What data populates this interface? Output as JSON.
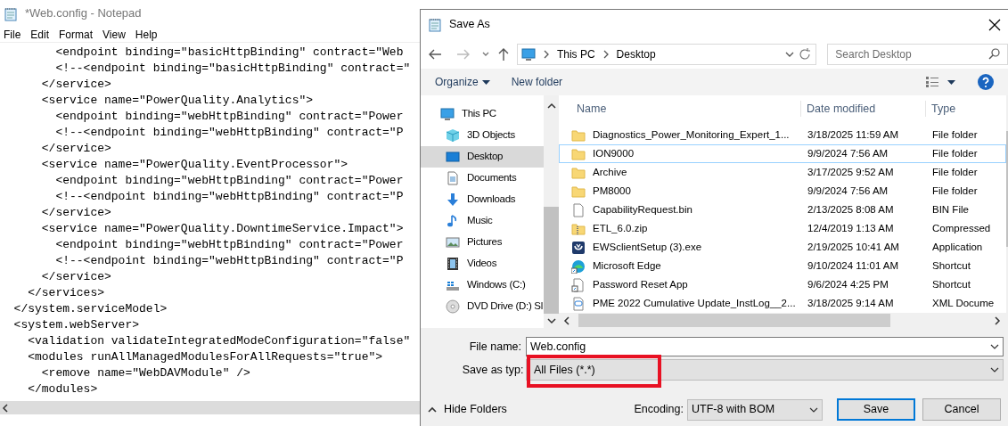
{
  "notepad": {
    "title": "*Web.config - Notepad",
    "menu": [
      "File",
      "Edit",
      "Format",
      "View",
      "Help"
    ],
    "lines": [
      "        <endpoint binding=\"basicHttpBinding\" contract=\"Web",
      "        <!--<endpoint binding=\"basicHttpBinding\" contract=\"",
      "      </service>",
      "      <service name=\"PowerQuality.Analytics\">",
      "        <endpoint binding=\"webHttpBinding\" contract=\"Power",
      "        <!--<endpoint binding=\"webHttpBinding\" contract=\"P",
      "      </service>",
      "      <service name=\"PowerQuality.EventProcessor\">",
      "        <endpoint binding=\"webHttpBinding\" contract=\"Power",
      "        <!--<endpoint binding=\"webHttpBinding\" contract=\"P",
      "      </service>",
      "      <service name=\"PowerQuality.DowntimeService.Impact\">",
      "        <endpoint binding=\"webHttpBinding\" contract=\"Power",
      "        <!--<endpoint binding=\"webHttpBinding\" contract=\"P",
      "      </service>",
      "    </services>",
      "  </system.serviceModel>",
      "  <system.webServer>",
      "    <validation validateIntegratedModeConfiguration=\"false\"",
      "    <modules runAllManagedModulesForAllRequests=\"true\">",
      "      <remove name=\"WebDAVModule\" />",
      "    </modules>"
    ]
  },
  "dialog": {
    "title": "Save As",
    "breadcrumb": [
      "This PC",
      "Desktop"
    ],
    "search": {
      "placeholder": "Search Desktop"
    },
    "toolbar": {
      "organize": "Organize",
      "new_folder": "New folder"
    },
    "nav_items": [
      {
        "kind": "pc",
        "label": "This PC",
        "selected": false
      },
      {
        "kind": "cube",
        "label": "3D Objects",
        "selected": false
      },
      {
        "kind": "desktop",
        "label": "Desktop",
        "selected": true
      },
      {
        "kind": "documents",
        "label": "Documents",
        "selected": false
      },
      {
        "kind": "downloads",
        "label": "Downloads",
        "selected": false
      },
      {
        "kind": "music",
        "label": "Music",
        "selected": false
      },
      {
        "kind": "pictures",
        "label": "Pictures",
        "selected": false
      },
      {
        "kind": "videos",
        "label": "Videos",
        "selected": false
      },
      {
        "kind": "drive",
        "label": "Windows (C:)",
        "selected": false
      },
      {
        "kind": "dvd",
        "label": "DVD Drive (D:) Sl",
        "selected": false
      }
    ],
    "columns": [
      "Name",
      "Date modified",
      "Type"
    ],
    "files": [
      {
        "kind": "folder",
        "name": "Diagnostics_Power_Monitoring_Expert_1...",
        "date": "3/18/2025 11:59 AM",
        "type": "File folder",
        "focused": false
      },
      {
        "kind": "folder",
        "name": "ION9000",
        "date": "9/9/2024 7:56 AM",
        "type": "File folder",
        "focused": true
      },
      {
        "kind": "folder",
        "name": "Archive",
        "date": "3/17/2025 9:52 AM",
        "type": "File folder",
        "focused": false
      },
      {
        "kind": "folder",
        "name": "PM8000",
        "date": "9/9/2024 7:56 AM",
        "type": "File folder",
        "focused": false
      },
      {
        "kind": "file",
        "name": "CapabilityRequest.bin",
        "date": "2/13/2025 8:08 AM",
        "type": "BIN File",
        "focused": false
      },
      {
        "kind": "zip",
        "name": "ETL_6.0.zip",
        "date": "12/4/2019 1:13 AM",
        "type": "Compressed",
        "focused": false
      },
      {
        "kind": "installer",
        "name": "EWSclientSetup (3).exe",
        "date": "2/19/2025 10:41 AM",
        "type": "Application",
        "focused": false
      },
      {
        "kind": "edge",
        "name": "Microsoft Edge",
        "date": "9/10/2024 11:01 AM",
        "type": "Shortcut",
        "focused": false
      },
      {
        "kind": "shortcut",
        "name": "Password Reset App",
        "date": "9/6/2024 4:25 PM",
        "type": "Shortcut",
        "focused": false
      },
      {
        "kind": "xml",
        "name": "PME 2022 Cumulative Update_InstLog__2...",
        "date": "3/18/2025 9:14 AM",
        "type": "XML Docume",
        "focused": false
      }
    ],
    "file_name": {
      "label": "File name:",
      "value": "Web.config"
    },
    "save_type": {
      "label": "Save as typ",
      "colon": ":",
      "value": "All Files  (*.*)",
      "highlighted": true
    },
    "hide_folders": "Hide Folders",
    "encoding": {
      "label": "Encoding:",
      "value": "UTF-8 with BOM"
    },
    "buttons": [
      "Save",
      "Cancel"
    ]
  }
}
